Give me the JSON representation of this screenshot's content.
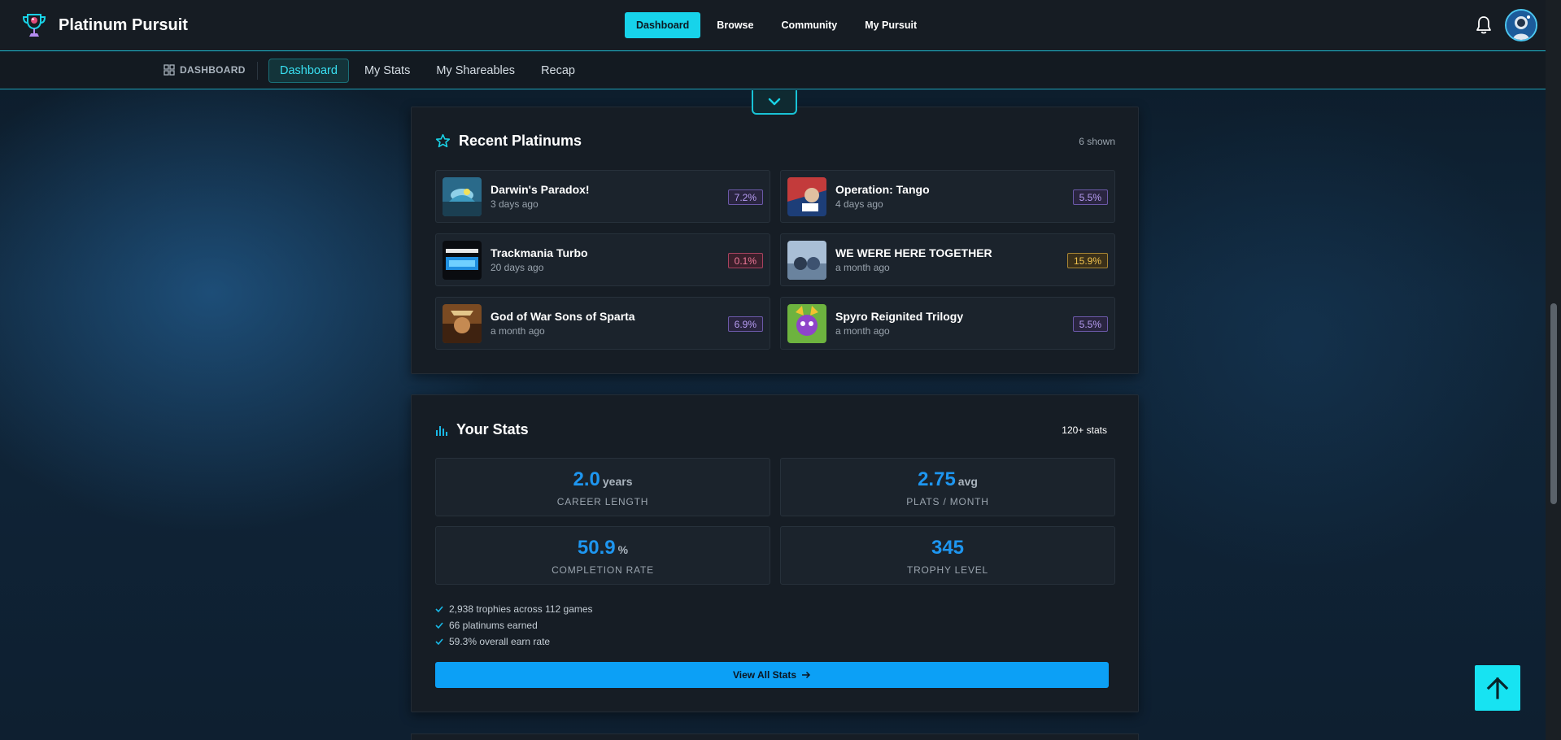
{
  "app": {
    "name": "Platinum Pursuit"
  },
  "main_nav": [
    {
      "label": "Dashboard",
      "active": true
    },
    {
      "label": "Browse",
      "active": false
    },
    {
      "label": "Community",
      "active": false
    },
    {
      "label": "My Pursuit",
      "active": false
    }
  ],
  "subnav": {
    "section_label": "DASHBOARD",
    "tabs": [
      {
        "label": "Dashboard",
        "active": true
      },
      {
        "label": "My Stats",
        "active": false
      },
      {
        "label": "My Shareables",
        "active": false
      },
      {
        "label": "Recap",
        "active": false
      }
    ]
  },
  "recent_platinums": {
    "title": "Recent Platinums",
    "count_label": "6 shown",
    "items": [
      {
        "title": "Darwin's Paradox!",
        "when": "3 days ago",
        "rarity": "7.2%",
        "rarity_style": "purple"
      },
      {
        "title": "Operation: Tango",
        "when": "4 days ago",
        "rarity": "5.5%",
        "rarity_style": "purple"
      },
      {
        "title": "Trackmania Turbo",
        "when": "20 days ago",
        "rarity": "0.1%",
        "rarity_style": "red"
      },
      {
        "title": "WE WERE HERE TOGETHER",
        "when": "a month ago",
        "rarity": "15.9%",
        "rarity_style": "gold"
      },
      {
        "title": "God of War Sons of Sparta",
        "when": "a month ago",
        "rarity": "6.9%",
        "rarity_style": "purple"
      },
      {
        "title": "Spyro Reignited Trilogy",
        "when": "a month ago",
        "rarity": "5.5%",
        "rarity_style": "purple"
      }
    ]
  },
  "your_stats": {
    "title": "Your Stats",
    "count_label": "120+ stats",
    "tiles": [
      {
        "value": "2.0",
        "unit": "years",
        "caption": "CAREER LENGTH"
      },
      {
        "value": "2.75",
        "unit": "avg",
        "caption": "PLATS / MONTH"
      },
      {
        "value": "50.9",
        "unit": "%",
        "caption": "COMPLETION RATE"
      },
      {
        "value": "345",
        "unit": "",
        "caption": "TROPHY LEVEL"
      }
    ],
    "highlights": [
      "2,938 trophies across 112 games",
      "66 platinums earned",
      "59.3% overall earn rate"
    ],
    "cta_label": "View All Stats"
  },
  "colors": {
    "accent_cyan": "#17d3ea",
    "accent_blue": "#0ca0f6",
    "stat_value": "#1e96f0"
  }
}
